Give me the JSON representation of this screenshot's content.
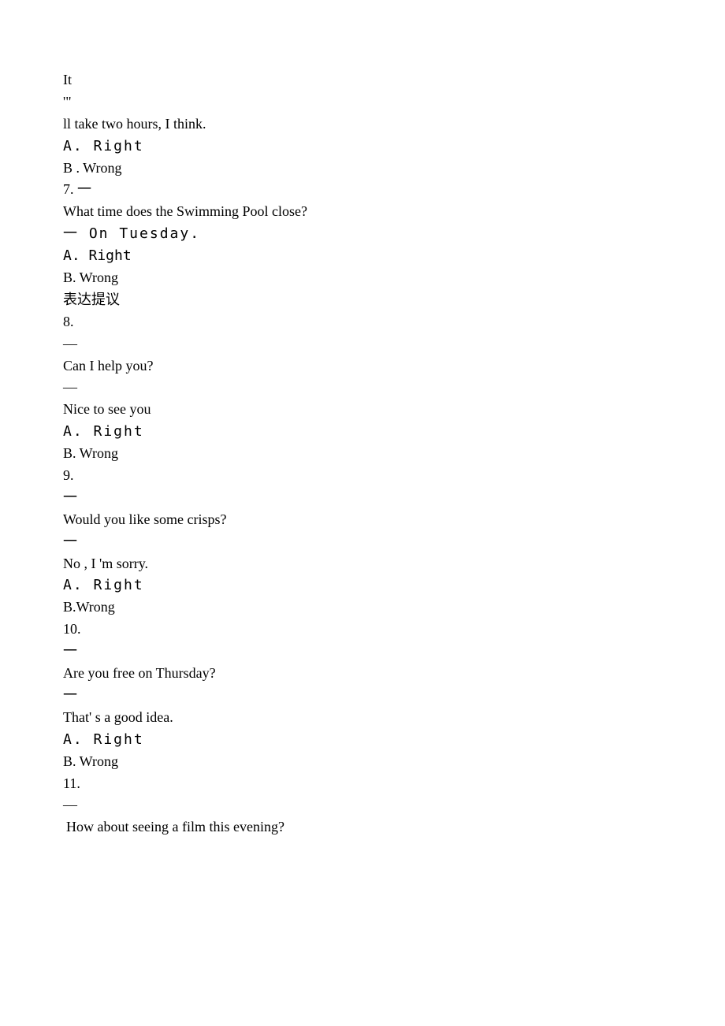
{
  "lines": {
    "l1": "It",
    "l2": "'\"",
    "l3": "ll take two hours, I think.",
    "l4": "A.  Right",
    "l5": "B . Wrong",
    "l6": "7.  一",
    "l7": "What time does the Swimming Pool close?",
    "l8": "一 On  Tuesday.",
    "l9": "A. Right",
    "l10": "B. Wrong",
    "l11": "表达提议",
    "l12": "8.",
    "l13": "—",
    "l14": "Can I help you?",
    "l15": "—",
    "l16": "Nice to see you",
    "l17": "A.  Right",
    "l18": "B. Wrong",
    "l19": "9.",
    "l20": "一",
    "l21": "Would you like some crisps?",
    "l22": "一",
    "l23": "No , I 'm sorry.",
    "l24": "A.  Right",
    "l25": "B.Wrong",
    "l26": "10.",
    "l27": "一",
    "l28": "Are you free on Thursday?",
    "l29": "一",
    "l30": "That' s a good idea.",
    "l31": "A.  Right",
    "l32": "B. Wrong",
    "l33": "11.",
    "l34": "—",
    "l35": " How about seeing a film this evening?"
  }
}
